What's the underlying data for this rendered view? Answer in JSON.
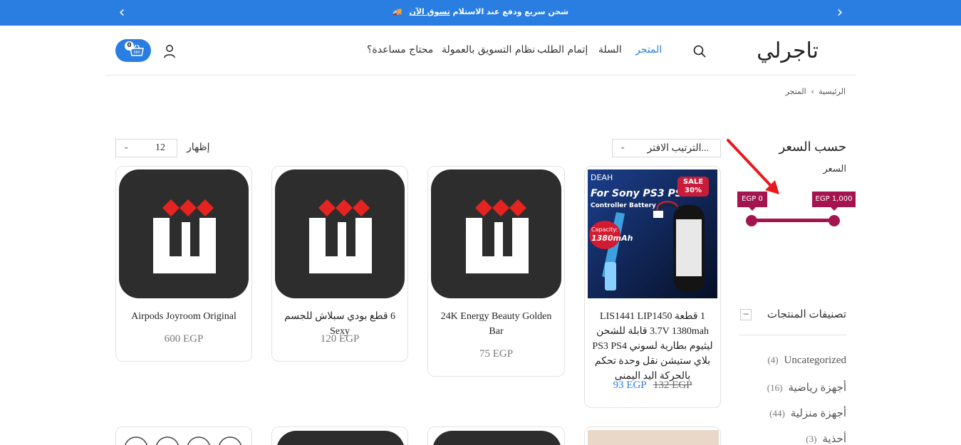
{
  "announcement": {
    "text": "🚚 شحن سريع ودفع عند الاستلام",
    "link": "تسوق الآن"
  },
  "header": {
    "logo": "تاجرلي",
    "nav": [
      "المتجر",
      "السلة",
      "إتمام الطلب",
      "نظام التسويق بالعمولة",
      "محتاج مساعدة؟"
    ],
    "cart_count": "0"
  },
  "breadcrumb": {
    "home": "الرئيسية",
    "sep": "›",
    "current": "المتجر"
  },
  "toolbar": {
    "sort_value": "الترتيب الافتر...",
    "show_label": "إظهار",
    "per_page": "12"
  },
  "sidebar": {
    "price_title": "حسب السعر",
    "price_label": "السعر",
    "price_min": "EGP 0",
    "price_max": "EGP 1,000",
    "categories_title": "تصنيفات المنتجات",
    "collapse_symbol": "−",
    "categories": [
      {
        "name": "Uncategorized",
        "count": "(4)"
      },
      {
        "name": "أجهزة رياضية",
        "count": "(16)"
      },
      {
        "name": "أجهزة منزلية",
        "count": "(44)"
      },
      {
        "name": "أحذية",
        "count": "(3)"
      }
    ]
  },
  "products": [
    {
      "title": "1 قطعة LIS1441 LIP1450 3.7V 1380mah قابلة للشحن ليثيوم بطارية لسوني PS3 PS4 بلاي ستيشن نقل وحدة تحكم بالحركة اليد اليمنى",
      "price": "93 EGP",
      "old_price": "132 EGP",
      "badge": "SALE 30%",
      "photo_brand": "DEAH",
      "photo_headline": "For Sony PS3 PS4",
      "photo_sub": "Controller Battery",
      "photo_capacity_label": "Capacity:",
      "photo_capacity": "1380mAh"
    },
    {
      "title": "24K Energy Beauty Golden Bar",
      "price": "75 EGP"
    },
    {
      "title": "6 قطع بودي سبلاش للجسم Sexy",
      "price": "120 EGP"
    },
    {
      "title": "Airpods Joyroom Original",
      "price": "600 EGP"
    }
  ],
  "colors": {
    "brand_blue": "#2a7de1",
    "slider": "#a4144e",
    "thumb_dark": "#2e2d2d",
    "logo_red": "#e52421",
    "annotation_arrow": "#e8191c"
  }
}
